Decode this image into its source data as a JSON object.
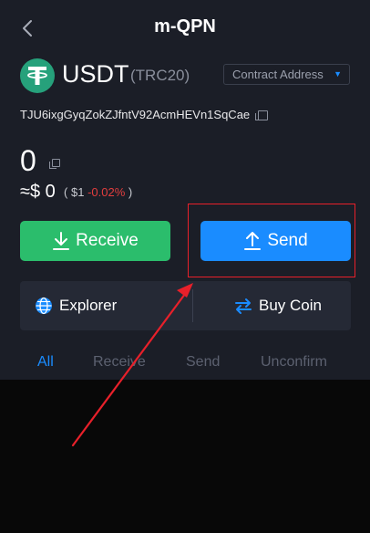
{
  "header": {
    "title": "m-QPN"
  },
  "token": {
    "symbol": "USDT",
    "network": "(TRC20)",
    "contract_label": "Contract Address",
    "address": "TJU6ixgGyqZokZJfntV92AcmHEVn1SqCae",
    "balance": "0",
    "fiat_value": "≈$ 0",
    "price_open": "(",
    "price": "$1",
    "change": "-0.02%",
    "price_close": ")"
  },
  "actions": {
    "receive_label": "Receive",
    "send_label": "Send",
    "explorer_label": "Explorer",
    "buy_label": "Buy Coin"
  },
  "tabs": [
    {
      "label": "All",
      "active": true
    },
    {
      "label": "Receive",
      "active": false
    },
    {
      "label": "Send",
      "active": false
    },
    {
      "label": "Unconfirm",
      "active": false
    }
  ],
  "colors": {
    "send": "#1a8cff",
    "receive": "#2bbd6c",
    "negative": "#e23e3e",
    "annotation": "#e8202a"
  }
}
